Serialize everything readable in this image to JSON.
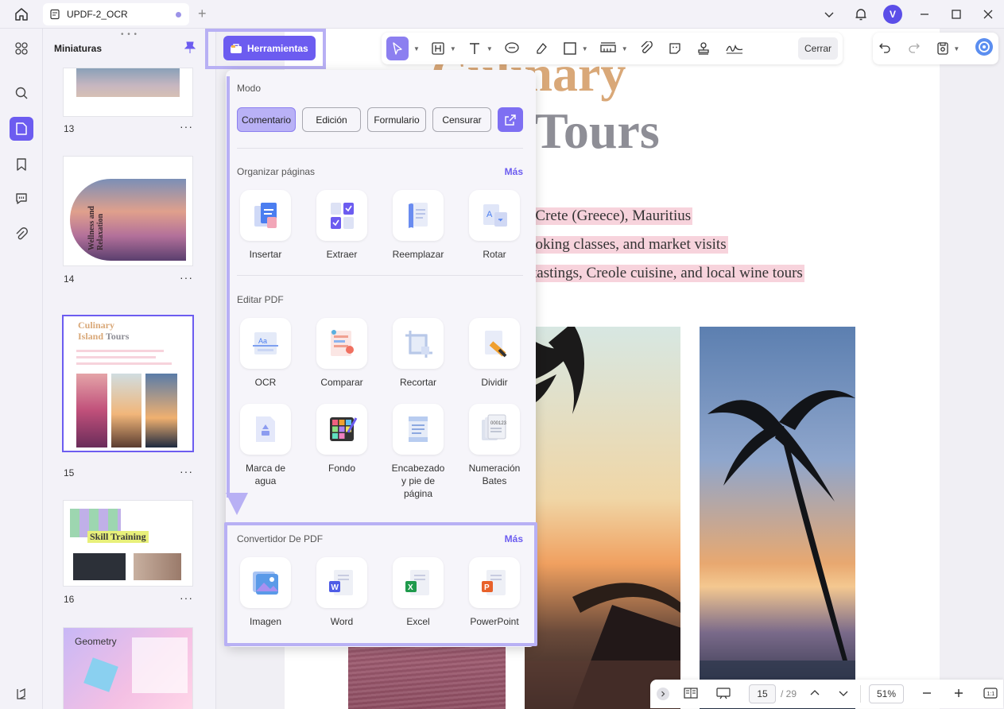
{
  "tab": {
    "title": "UPDF-2_OCR"
  },
  "user": {
    "initial": "V"
  },
  "thumbnails": {
    "header": "Miniaturas",
    "pages": [
      {
        "num": "13"
      },
      {
        "num": "14",
        "title": "Wellness and Relaxation"
      },
      {
        "num": "15",
        "title_line1": "Culinary",
        "title_line2a": "Island",
        "title_line2b": "Tours"
      },
      {
        "num": "16",
        "title": "Skill Training"
      },
      {
        "title": "Geometry"
      }
    ]
  },
  "toolbar": {
    "close_label": "Cerrar"
  },
  "herramientas": {
    "label": "Herramientas"
  },
  "document": {
    "title1": "Culinary",
    "title2": "Tours",
    "lines": [
      "s: Crete (Greece), Mauritius",
      "ooking classes, and market visits",
      " tastings, Creole cuisine, and local wine tours"
    ]
  },
  "panel": {
    "mode": {
      "title": "Modo",
      "buttons": [
        "Comentario",
        "Edición",
        "Formulario",
        "Censurar"
      ]
    },
    "organize": {
      "title": "Organizar páginas",
      "more": "Más",
      "tools": [
        "Insertar",
        "Extraer",
        "Reemplazar",
        "Rotar"
      ]
    },
    "edit": {
      "title": "Editar PDF",
      "tools": [
        "OCR",
        "Comparar",
        "Recortar",
        "Dividir"
      ],
      "tools2": [
        {
          "line1": "Marca de",
          "line2": "agua"
        },
        {
          "line1": "Fondo"
        },
        {
          "line1": "Encabezado",
          "line2": "y pie de",
          "line3": "página"
        },
        {
          "line1": "Numeración",
          "line2": "Bates"
        }
      ]
    },
    "convert": {
      "title": "Convertidor De PDF",
      "more": "Más",
      "tools": [
        "Imagen",
        "Word",
        "Excel",
        "PowerPoint"
      ]
    }
  },
  "bottombar": {
    "page": "15",
    "total": "/ 29",
    "zoom": "51%"
  },
  "colors": {
    "accent": "#6c5cf0",
    "highlight": "#b8b0f4",
    "text_highlight": "#f7d3dc"
  }
}
